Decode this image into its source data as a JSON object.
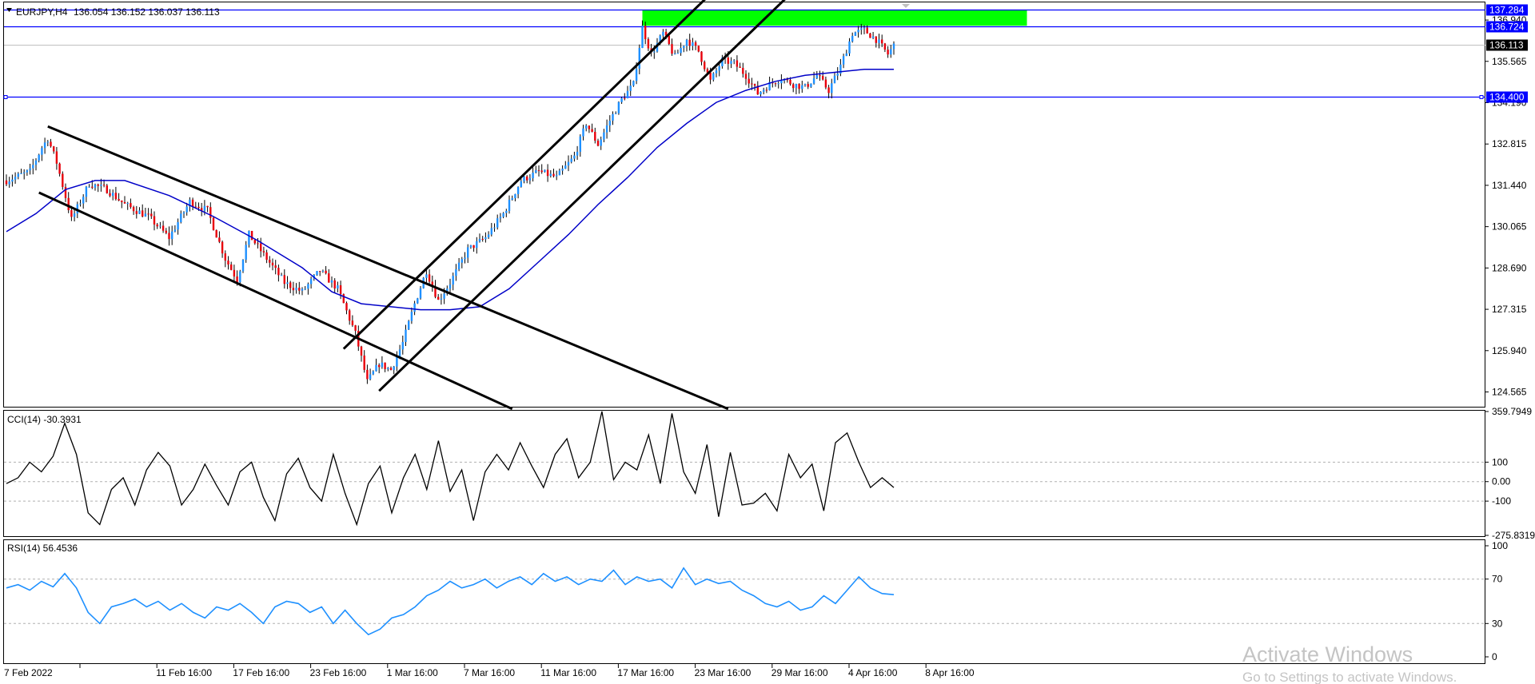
{
  "header": {
    "symbol": "EURJPY,H4",
    "ohlc": "136.054 136.152 136.037 136.113"
  },
  "colors": {
    "bull": "#1e90ff",
    "bear": "#e8000b",
    "wick": "#000000",
    "ma": "#0000c8",
    "hline": "#0000ff",
    "zone": "#00ff00",
    "oscillator": "#000000",
    "rsi": "#1e90ff",
    "channel": "#000000"
  },
  "chart_data": [
    {
      "type": "candlestick",
      "title": "EURJPY,H4",
      "ylim": [
        124.1,
        137.5
      ],
      "yticks": [
        "124.565",
        "125.940",
        "127.315",
        "128.690",
        "130.065",
        "131.440",
        "132.815",
        "134.190",
        "135.565",
        "136.940"
      ],
      "x_tick_labels": [
        "7 Feb 2022",
        "11 Feb 16:00",
        "17 Feb 16:00",
        "23 Feb 16:00",
        "1 Mar 16:00",
        "7 Mar 16:00",
        "11 Mar 16:00",
        "17 Mar 16:00",
        "23 Mar 16:00",
        "29 Mar 16:00",
        "4 Apr 16:00",
        "8 Apr 16:00"
      ],
      "close_anchors": [
        [
          0,
          131.6
        ],
        [
          8,
          131.9
        ],
        [
          12,
          132.7
        ],
        [
          14,
          133.0
        ],
        [
          17,
          132.2
        ],
        [
          22,
          130.3
        ],
        [
          28,
          131.5
        ],
        [
          34,
          131.3
        ],
        [
          40,
          130.8
        ],
        [
          48,
          130.4
        ],
        [
          55,
          129.7
        ],
        [
          62,
          130.9
        ],
        [
          68,
          130.6
        ],
        [
          74,
          129.0
        ],
        [
          78,
          128.3
        ],
        [
          82,
          129.8
        ],
        [
          88,
          129.0
        ],
        [
          94,
          128.2
        ],
        [
          100,
          127.9
        ],
        [
          106,
          128.6
        ],
        [
          112,
          128.0
        ],
        [
          118,
          126.5
        ],
        [
          122,
          124.9
        ],
        [
          126,
          125.5
        ],
        [
          130,
          125.3
        ],
        [
          134,
          126.2
        ],
        [
          138,
          127.5
        ],
        [
          142,
          128.6
        ],
        [
          146,
          127.6
        ],
        [
          150,
          128.2
        ],
        [
          156,
          129.3
        ],
        [
          162,
          129.7
        ],
        [
          168,
          130.5
        ],
        [
          174,
          131.6
        ],
        [
          180,
          131.9
        ],
        [
          186,
          131.7
        ],
        [
          192,
          132.4
        ],
        [
          196,
          133.5
        ],
        [
          200,
          132.8
        ],
        [
          204,
          133.6
        ],
        [
          208,
          134.3
        ],
        [
          212,
          134.8
        ],
        [
          215,
          136.7
        ],
        [
          218,
          135.8
        ],
        [
          222,
          136.5
        ],
        [
          226,
          135.7
        ],
        [
          230,
          136.3
        ],
        [
          234,
          135.9
        ],
        [
          238,
          134.9
        ],
        [
          242,
          135.6
        ],
        [
          246,
          135.5
        ],
        [
          250,
          135.1
        ],
        [
          254,
          134.5
        ],
        [
          258,
          134.8
        ],
        [
          262,
          135.0
        ],
        [
          266,
          134.8
        ],
        [
          270,
          134.7
        ],
        [
          274,
          135.1
        ],
        [
          278,
          134.6
        ],
        [
          282,
          135.4
        ],
        [
          286,
          136.5
        ],
        [
          290,
          136.6
        ],
        [
          294,
          136.3
        ],
        [
          298,
          135.8
        ],
        [
          300,
          136.1
        ]
      ],
      "moving_average": [
        [
          0,
          129.9
        ],
        [
          10,
          130.5
        ],
        [
          20,
          131.3
        ],
        [
          30,
          131.6
        ],
        [
          40,
          131.6
        ],
        [
          55,
          131.1
        ],
        [
          70,
          130.4
        ],
        [
          85,
          129.6
        ],
        [
          100,
          128.7
        ],
        [
          110,
          127.9
        ],
        [
          120,
          127.5
        ],
        [
          130,
          127.4
        ],
        [
          140,
          127.3
        ],
        [
          150,
          127.3
        ],
        [
          160,
          127.4
        ],
        [
          170,
          128.0
        ],
        [
          180,
          128.9
        ],
        [
          190,
          129.8
        ],
        [
          200,
          130.8
        ],
        [
          210,
          131.7
        ],
        [
          220,
          132.7
        ],
        [
          230,
          133.5
        ],
        [
          240,
          134.2
        ],
        [
          250,
          134.6
        ],
        [
          260,
          134.9
        ],
        [
          270,
          135.1
        ],
        [
          280,
          135.2
        ],
        [
          290,
          135.3
        ],
        [
          300,
          135.3
        ]
      ],
      "horizontal_levels": [
        {
          "value": 137.284,
          "label": "137.284"
        },
        {
          "value": 136.724,
          "label": "136.724"
        },
        {
          "value": 134.4,
          "label": "134.400"
        }
      ],
      "current_price": {
        "value": 136.113,
        "label": "136.113"
      },
      "resistance_zone": {
        "from_bar": 215,
        "to_bar": 345,
        "low": 136.75,
        "high": 137.28
      },
      "trendlines": [
        {
          "from": [
            14,
            133.4
          ],
          "to": [
            244,
            124.0
          ]
        },
        {
          "from": [
            11,
            131.2
          ],
          "to": [
            171,
            124.0
          ]
        },
        {
          "from": [
            114,
            126.0
          ],
          "to": [
            239,
            137.9
          ]
        },
        {
          "from": [
            126,
            124.6
          ],
          "to": [
            266,
            137.9
          ]
        }
      ]
    },
    {
      "type": "line",
      "title": "CCI(14) -30.3931",
      "ylim": [
        -275.8319,
        359.7949
      ],
      "yticks": [
        "359.7949",
        "100",
        "0.00",
        "-100",
        "-275.8319"
      ],
      "levels": [
        100,
        0,
        -100
      ],
      "values": [
        -10,
        20,
        100,
        50,
        130,
        300,
        140,
        -160,
        -220,
        -40,
        20,
        -120,
        60,
        150,
        80,
        -120,
        -40,
        90,
        -20,
        -120,
        50,
        100,
        -80,
        -200,
        40,
        120,
        -30,
        -100,
        140,
        -60,
        -220,
        -10,
        80,
        -160,
        20,
        140,
        -40,
        210,
        -50,
        60,
        -200,
        50,
        140,
        60,
        200,
        80,
        -30,
        140,
        220,
        20,
        100,
        360,
        10,
        100,
        60,
        240,
        -10,
        350,
        50,
        -60,
        190,
        -180,
        150,
        -120,
        -110,
        -60,
        -150,
        140,
        20,
        90,
        -150,
        200,
        250,
        100,
        -30,
        20,
        -30
      ]
    },
    {
      "type": "line",
      "title": "RSI(14) 56.4536",
      "ylim": [
        0,
        100
      ],
      "yticks": [
        "100",
        "70",
        "30",
        "0"
      ],
      "levels": [
        70,
        30
      ],
      "values": [
        62,
        65,
        60,
        68,
        63,
        75,
        62,
        40,
        30,
        45,
        48,
        52,
        45,
        50,
        42,
        48,
        40,
        35,
        45,
        42,
        48,
        40,
        30,
        45,
        50,
        48,
        40,
        45,
        30,
        42,
        30,
        20,
        25,
        35,
        38,
        45,
        55,
        60,
        68,
        62,
        65,
        70,
        62,
        68,
        72,
        65,
        75,
        68,
        72,
        65,
        70,
        68,
        78,
        65,
        72,
        68,
        70,
        62,
        80,
        65,
        70,
        66,
        68,
        60,
        55,
        48,
        45,
        50,
        42,
        45,
        55,
        48,
        60,
        72,
        62,
        57,
        56
      ]
    }
  ],
  "watermark": {
    "line1": "Activate Windows",
    "line2": "Go to Settings to activate Windows."
  }
}
